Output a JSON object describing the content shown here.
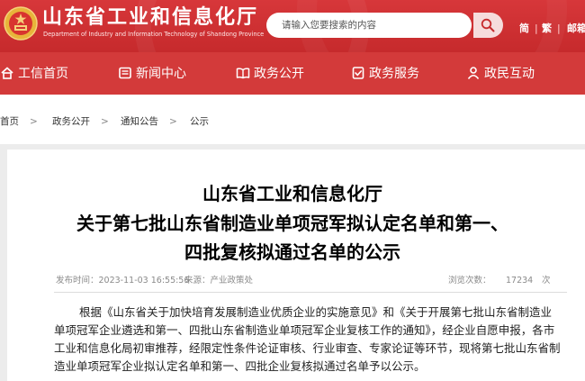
{
  "site": {
    "title": "山东省工业和信息化厅",
    "subtitle": "Department of Industry and Information Technology of Shandong Province"
  },
  "search": {
    "placeholder": "请输入您要搜索的内容"
  },
  "lang": {
    "simplified": "简",
    "traditional": "繁",
    "mailbox": "邮箱"
  },
  "nav": {
    "items": [
      {
        "label": "工信首页",
        "icon": "home-icon"
      },
      {
        "label": "新闻中心",
        "icon": "newspaper-icon"
      },
      {
        "label": "政务公开",
        "icon": "open-book-icon"
      },
      {
        "label": "政务服务",
        "icon": "service-icon"
      },
      {
        "label": "政民互动",
        "icon": "people-icon"
      }
    ]
  },
  "breadcrumb": [
    "首页",
    "政务公开",
    "通知公告",
    "公示"
  ],
  "breadcrumb_sep": ">",
  "article": {
    "title_lines": [
      "山东省工业和信息化厅",
      "关于第七批山东省制造业单项冠军拟认定名单和第一、",
      "四批复核拟通过名单的公示"
    ],
    "publish_time": "发布时间：2023-11-03 16:55:56",
    "source": "来源：产业政策处",
    "views_label": "浏览次数：",
    "views_count": "17234",
    "views_unit": "次",
    "paragraph_lines": [
      "根据《山东省关于加快培育发展制造业优质企业的实施意见》和《关于开展第七批山东省制造业",
      "单项冠军企业遴选和第一、四批山东省制造业单项冠军企业复核工作的通知》，经企业自愿申报，各市",
      "工业和信息化局初审推荐，经限定性条件论证审核、行业审查、专家论证等环节，现将第七批山东省制",
      "造业单项冠军企业拟认定名单和第一、四批企业复核拟通过名单予以公示。"
    ]
  },
  "colors": {
    "brand_red": "#c62a2c",
    "nav_red": "#d33a3a"
  }
}
